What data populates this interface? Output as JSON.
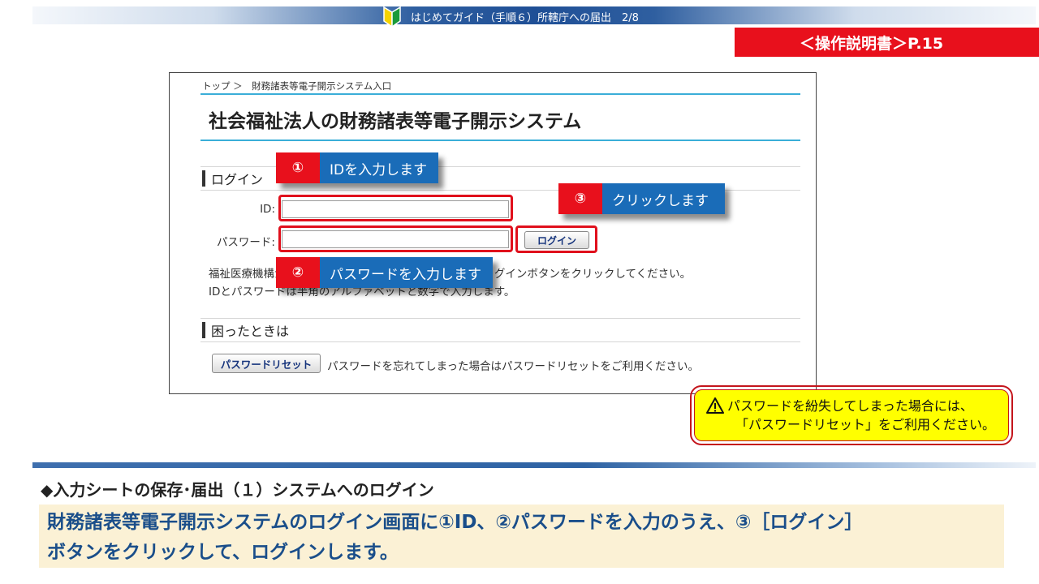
{
  "header": {
    "title": "はじめてガイド（手順６）所轄庁への届出　2/8",
    "leaf_icon": "beginner-leaf-icon"
  },
  "manual_ref": "＜操作説明書＞P.15",
  "screenshot": {
    "breadcrumb": "トップ ＞　財務諸表等電子開示システム入口",
    "system_title": "社会福祉法人の財務諸表等電子開示システム",
    "login_section": "ログイン",
    "id_label": "ID:",
    "id_value": "",
    "password_label": "パスワード:",
    "password_value": "",
    "login_button": "ログイン",
    "desc_line1": "福祉医療機構から通知されたIDとパスワードを入力し、ログインボタンをクリックしてください。",
    "desc_line2": "IDとパスワードは半角のアルファベットと数字で入力します。",
    "trouble_section": "困ったときは",
    "reset_button": "パスワードリセット",
    "reset_desc": "パスワードを忘れてしまった場合はパスワードリセットをご利用ください。"
  },
  "callouts": [
    {
      "num": "①",
      "text": "IDを入力します"
    },
    {
      "num": "②",
      "text": "パスワードを入力します"
    },
    {
      "num": "③",
      "text": "クリックします"
    }
  ],
  "warning": {
    "icon": "warning-triangle-icon",
    "line1": "パスワードを紛失してしまった場合には、",
    "line2": "「パスワードリセット」をご利用ください。"
  },
  "section_heading": "◆入力シートの保存･届出（１）システムへのログイン",
  "summary": {
    "line1": "財務諸表等電子開示システムのログイン画面に①ID、②パスワードを入力のうえ、③［ログイン］",
    "line2": "ボタンをクリックして、ログインします。"
  },
  "colors": {
    "accent_red": "#e8101c",
    "callout_blue": "#1a6cb8",
    "warning_yellow": "#ffff00",
    "summary_bg": "#fbf1d5",
    "summary_text": "#1a4e8a"
  }
}
